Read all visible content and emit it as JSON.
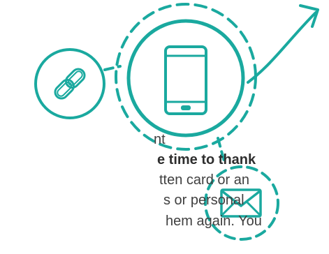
{
  "text_lines": [
    "nt",
    "e time to thank",
    "tten card or an",
    "s or personal",
    "hem again. You"
  ],
  "colors": {
    "accent": "#1aa99f",
    "text": "#3f3f3f"
  },
  "icons": [
    "link-icon",
    "phone-icon",
    "mail-icon",
    "arrow-icon"
  ]
}
